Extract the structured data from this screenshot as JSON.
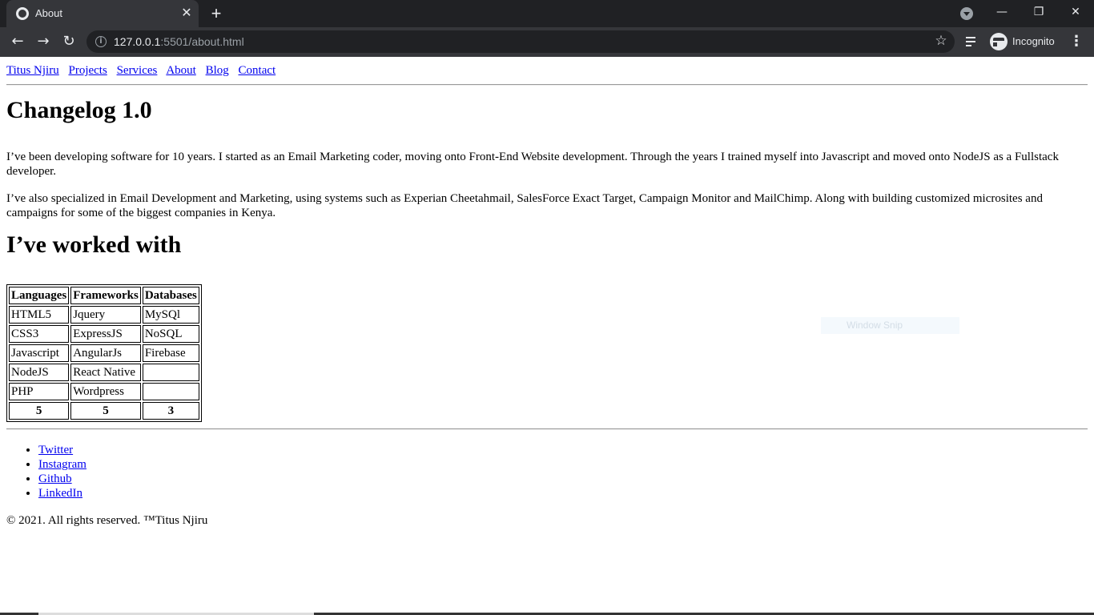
{
  "browser": {
    "tab_title": "About",
    "tab_close": "✕",
    "new_tab": "+",
    "url_host": "127.0.0.1",
    "url_rest": ":5501/about.html",
    "profile_label": "Incognito",
    "window_controls": {
      "minimize": "—",
      "restore": "❐",
      "close": "✕"
    }
  },
  "nav": {
    "brand": "Titus Njiru",
    "links": [
      "Projects",
      "Services",
      "About",
      "Blog",
      "Contact"
    ]
  },
  "main": {
    "heading": "Changelog 1.0",
    "paragraphs": [
      "I’ve been developing software for 10 years. I started as an Email Marketing coder, moving onto Front-End Website development. Through the years I trained myself into Javascript and moved onto NodeJS as a Fullstack developer.",
      "I’ve also specialized in Email Development and Marketing, using systems such as Experian Cheetahmail, SalesForce Exact Target, Campaign Monitor and MailChimp. Along with building customized microsites and campaigns for some of the biggest companies in Kenya."
    ],
    "subheading": "I’ve worked with",
    "table": {
      "headers": [
        "Languages",
        "Frameworks",
        "Databases"
      ],
      "rows": [
        [
          "HTML5",
          "Jquery",
          "MySQl"
        ],
        [
          "CSS3",
          "ExpressJS",
          "NoSQL"
        ],
        [
          "Javascript",
          "AngularJs",
          "Firebase"
        ],
        [
          "NodeJS",
          "React Native",
          ""
        ],
        [
          "PHP",
          "Wordpress",
          ""
        ]
      ],
      "totals": [
        "5",
        "5",
        "3"
      ]
    }
  },
  "footer": {
    "social_links": [
      "Twitter",
      "Instagram",
      "Github",
      "LinkedIn"
    ],
    "copyright": "© 2021. All rights reserved. ™Titus Njiru"
  },
  "overlay": {
    "snip_label": "Window Snip"
  }
}
